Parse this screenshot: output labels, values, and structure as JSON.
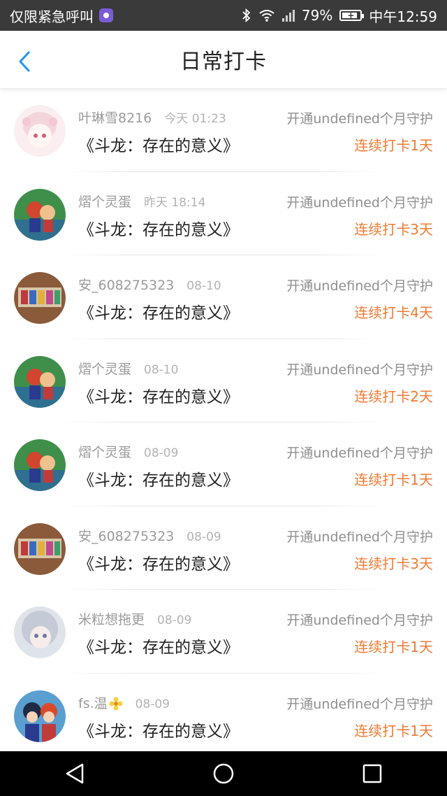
{
  "status_bar": {
    "left_text": "仅限紧急呼叫",
    "battery_percent": "79%",
    "time": "中午12:59",
    "app_badge_icon": "purple-app-icon",
    "icons": [
      "bluetooth-icon",
      "wifi-icon",
      "signal-icon",
      "battery-icon"
    ]
  },
  "header": {
    "title": "日常打卡",
    "back_icon": "chevron-left-icon",
    "accent_color": "#2196f3"
  },
  "list": [
    {
      "user": "叶琳雪8216",
      "time": "今天 01:23",
      "book": "《斗龙：存在的意义》",
      "guard": "开通undefined个月守护",
      "streak": "连续打卡1天",
      "avatar": "anime-girl-pink"
    },
    {
      "user": "熠个灵蛋",
      "time": "昨天 18:14",
      "book": "《斗龙：存在的意义》",
      "guard": "开通undefined个月守护",
      "streak": "连续打卡3天",
      "avatar": "anime-boys-green"
    },
    {
      "user": "安_608275323",
      "time": "08-10",
      "book": "《斗龙：存在的意义》",
      "guard": "开通undefined个月守护",
      "streak": "连续打卡4天",
      "avatar": "shelf-photo"
    },
    {
      "user": "熠个灵蛋",
      "time": "08-10",
      "book": "《斗龙：存在的意义》",
      "guard": "开通undefined个月守护",
      "streak": "连续打卡2天",
      "avatar": "anime-boys-green"
    },
    {
      "user": "熠个灵蛋",
      "time": "08-09",
      "book": "《斗龙：存在的意义》",
      "guard": "开通undefined个月守护",
      "streak": "连续打卡1天",
      "avatar": "anime-boys-green"
    },
    {
      "user": "安_608275323",
      "time": "08-09",
      "book": "《斗龙：存在的意义》",
      "guard": "开通undefined个月守护",
      "streak": "连续打卡3天",
      "avatar": "shelf-photo"
    },
    {
      "user": "米粒想拖更",
      "time": "08-09",
      "book": "《斗龙：存在的意义》",
      "guard": "开通undefined个月守护",
      "streak": "连续打卡1天",
      "avatar": "anime-girl-silver"
    },
    {
      "user": "fs.温",
      "time": "08-09",
      "book": "《斗龙：存在的意义》",
      "guard": "开通undefined个月守护",
      "streak": "连续打卡1天",
      "avatar": "anime-duo-dark",
      "user_emoji": "flower-icon"
    }
  ],
  "colors": {
    "streak": "#f07a33",
    "status_bar_bg": "#3a3a3a",
    "nav_bar_bg": "#000000"
  },
  "nav_bar": {
    "icons": [
      "back-triangle-icon",
      "home-circle-icon",
      "recents-square-icon"
    ]
  }
}
